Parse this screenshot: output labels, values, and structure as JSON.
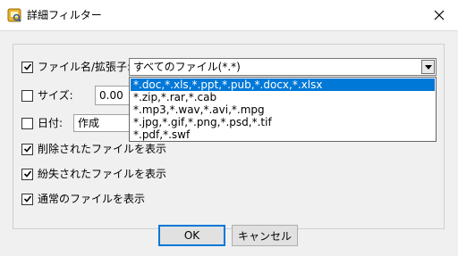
{
  "window": {
    "title": "詳細フィルター",
    "icons": {
      "app": "filter-app-icon",
      "close": "close-icon"
    }
  },
  "filters": {
    "filename": {
      "label": "ファイル名/拡張子:",
      "checked": true,
      "selected": "すべてのファイル(*.*)"
    },
    "size": {
      "label": "サイズ:",
      "checked": false,
      "value": "0.00"
    },
    "date": {
      "label": "日付:",
      "checked": false,
      "value": "作成"
    },
    "deleted": {
      "label": "削除されたファイルを表示",
      "checked": true
    },
    "lost": {
      "label": "紛失されたファイルを表示",
      "checked": true
    },
    "normal": {
      "label": "通常のファイルを表示",
      "checked": true
    }
  },
  "dropdown": {
    "options": [
      "*.doc,*.xls,*.ppt,*.pub,*.docx,*.xlsx",
      "*.zip,*.rar,*.cab",
      "*.mp3,*.wav,*.avi,*.mpg",
      "*.jpg,*.gif,*.png,*.psd,*.tif",
      "*.pdf,*.swf"
    ],
    "highlighted_index": 0,
    "highlight_color": "#0078d7"
  },
  "buttons": {
    "ok": "OK",
    "cancel": "キャンセル"
  }
}
